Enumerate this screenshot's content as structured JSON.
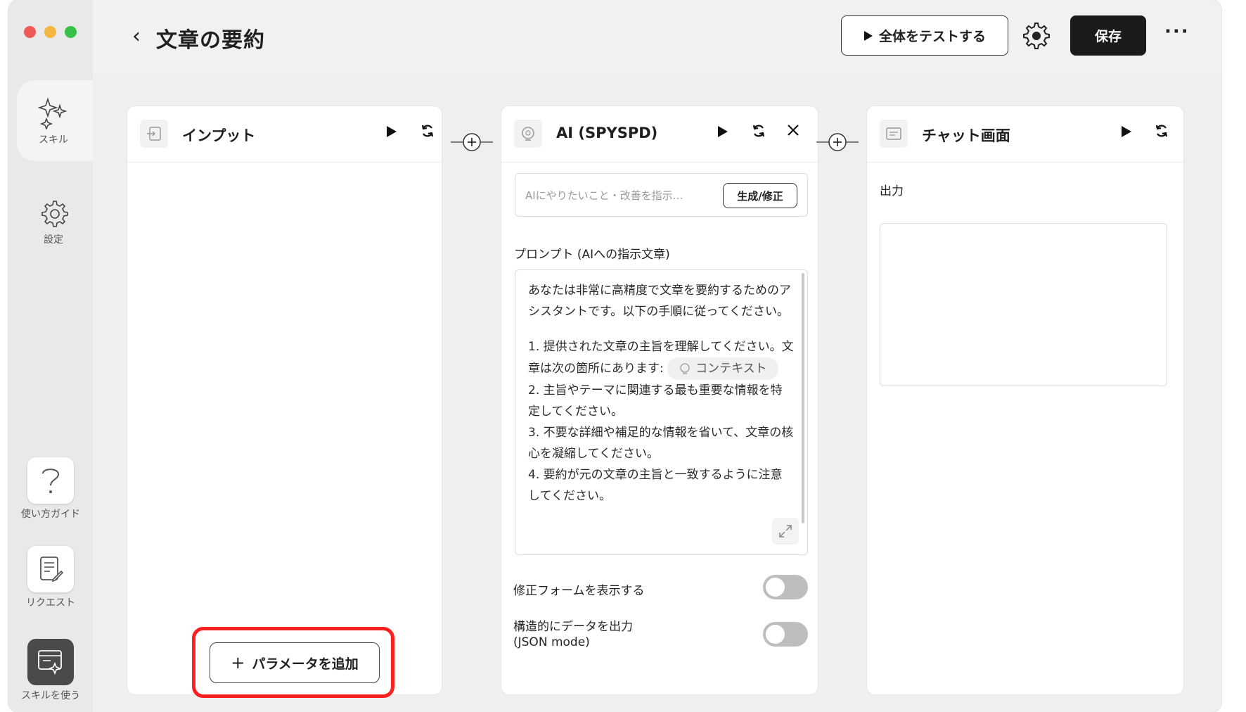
{
  "sidebar": {
    "items": [
      {
        "label": "スキル",
        "icon": "sparkles-icon",
        "active": true
      },
      {
        "label": "設定",
        "icon": "gear-icon",
        "active": false
      }
    ],
    "bottom_items": [
      {
        "label": "使い方ガイド",
        "icon": "question-icon"
      },
      {
        "label": "リクエスト",
        "icon": "request-note-icon"
      },
      {
        "label": "スキルを使う",
        "icon": "use-skill-icon"
      }
    ]
  },
  "header": {
    "back_icon": "‹",
    "title": "文章の要約",
    "test_all_label": "全体をテストする",
    "save_label": "保存",
    "more_icon": "···"
  },
  "panels": {
    "input": {
      "title": "インプット",
      "add_param_label": "パラメータを追加"
    },
    "ai": {
      "title": "AI (SPYSPD)",
      "instruction_placeholder": "AIにやりたいこと・改善を指示…",
      "generate_label": "生成/修正",
      "prompt_label": "プロンプト (AIへの指示文章)",
      "prompt_intro": "あなたは非常に高精度で文章を要約するためのアシスタントです。以下の手順に従ってください。",
      "step1_before_chip": "1. 提供された文章の主旨を理解してください。文章は次の箇所にあります: ",
      "chip_label": "コンテキスト",
      "step2": "2. 主旨やテーマに関連する最も重要な情報を特定してください。",
      "step3": "3. 不要な詳細や補足的な情報を省いて、文章の核心を凝縮してください。",
      "step4": "4. 要約が元の文章の主旨と一致するように注意してください。",
      "toggle1_label": "修正フォームを表示する",
      "toggle2_label_line1": "構造的にデータを出力",
      "toggle2_label_line2": "(JSON mode)",
      "toggle1_on": false,
      "toggle2_on": false
    },
    "chat": {
      "title": "チャット画面",
      "output_label": "出力"
    }
  },
  "colors": {
    "highlight": "#ff1f1f",
    "primary_button": "#1a1a1a"
  }
}
